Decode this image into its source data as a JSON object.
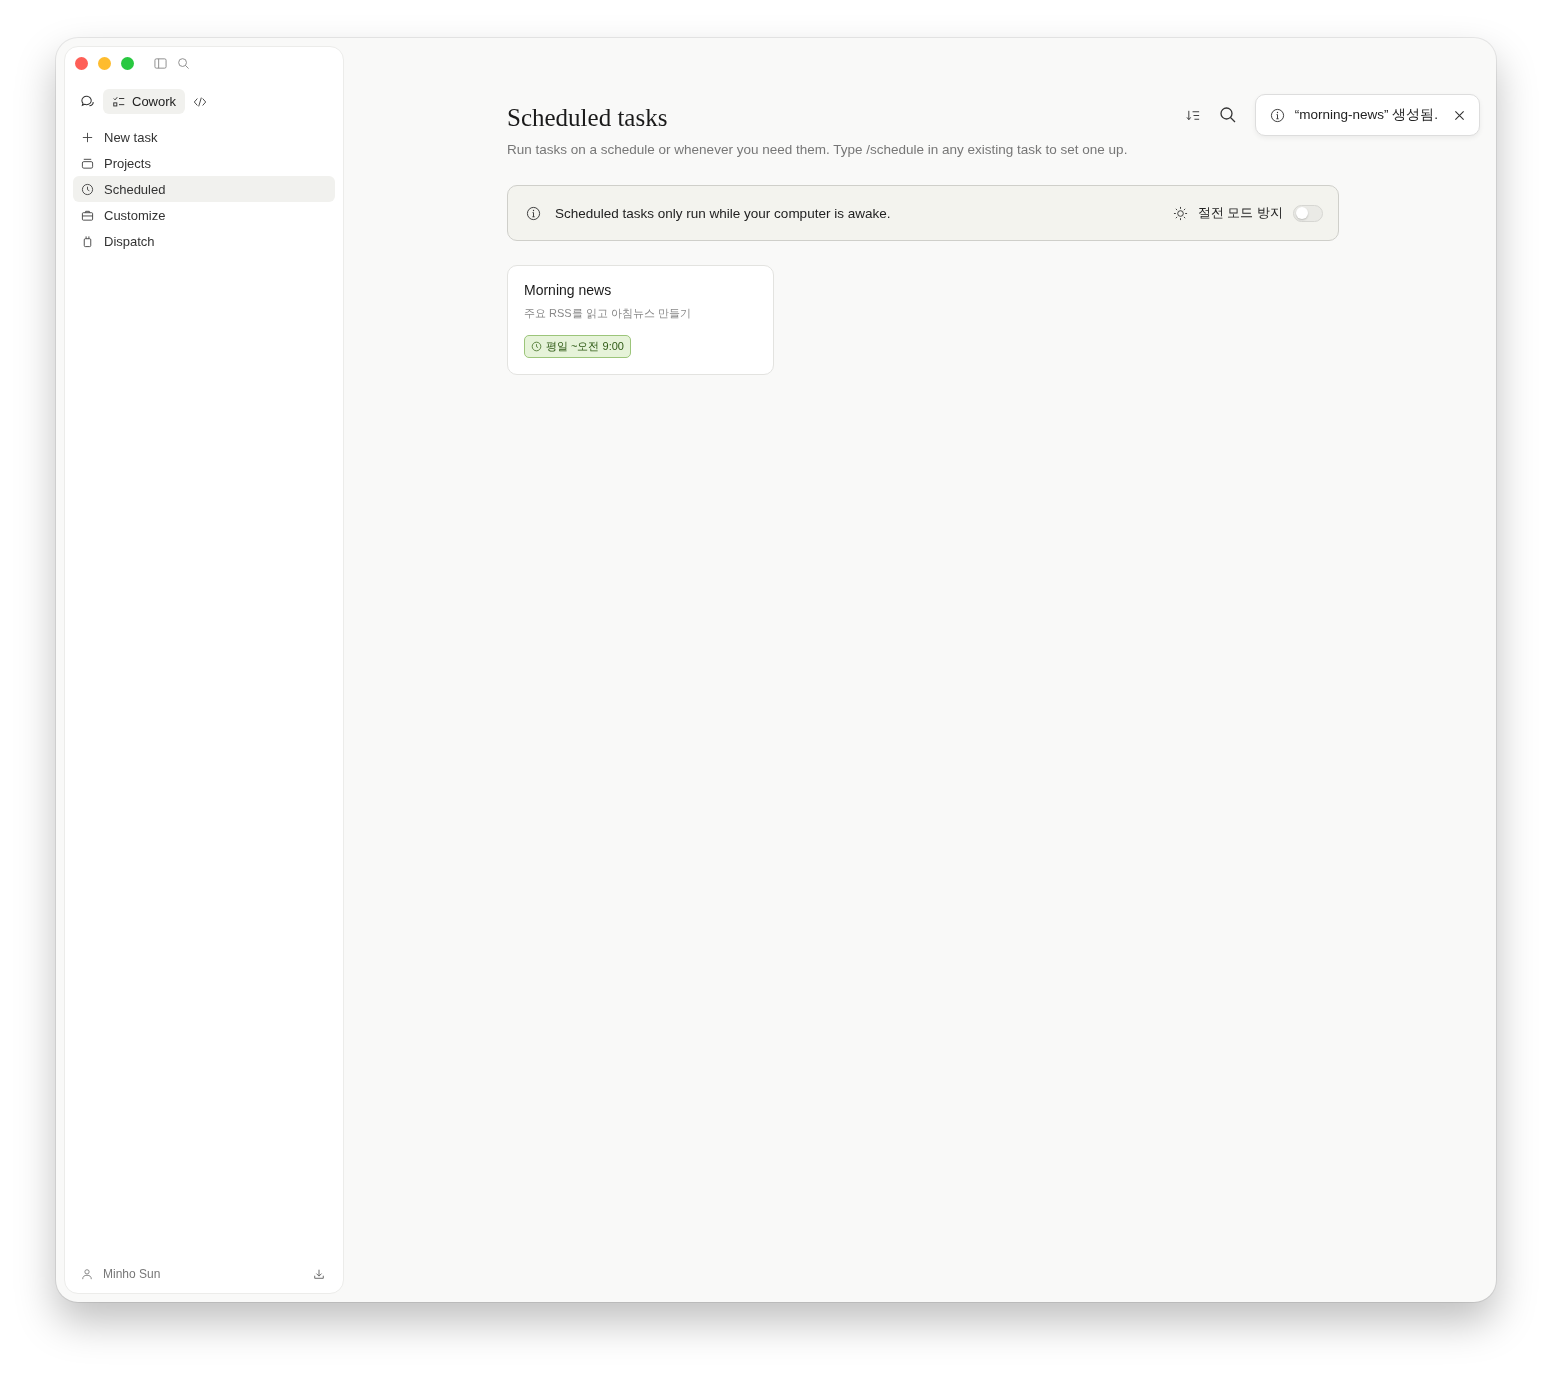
{
  "sidebar": {
    "mode": {
      "label": "Cowork",
      "selected": true
    },
    "items": [
      {
        "kind": "add",
        "label": "New task",
        "selected": false
      },
      {
        "kind": "folder",
        "label": "Projects",
        "selected": false
      },
      {
        "kind": "clock",
        "label": "Scheduled",
        "selected": true
      },
      {
        "kind": "case",
        "label": "Customize",
        "selected": false
      },
      {
        "kind": "device",
        "label": "Dispatch",
        "selected": false
      }
    ],
    "user": {
      "name": "Minho Sun"
    }
  },
  "header": {
    "title": "Scheduled tasks",
    "subtitle": "Run tasks on a schedule or whenever you need them. Type /schedule in any existing task to set one up."
  },
  "toast": {
    "message": "“morning-news” 생성됨."
  },
  "notice": {
    "text": "Scheduled tasks only run while your computer is awake.",
    "toggle_label": "절전 모드 방지",
    "on": false
  },
  "tasks": [
    {
      "title": "Morning news",
      "description": "주요 RSS를 읽고 아침뉴스 만들기",
      "schedule": "평일 ~오전 9:00"
    }
  ]
}
